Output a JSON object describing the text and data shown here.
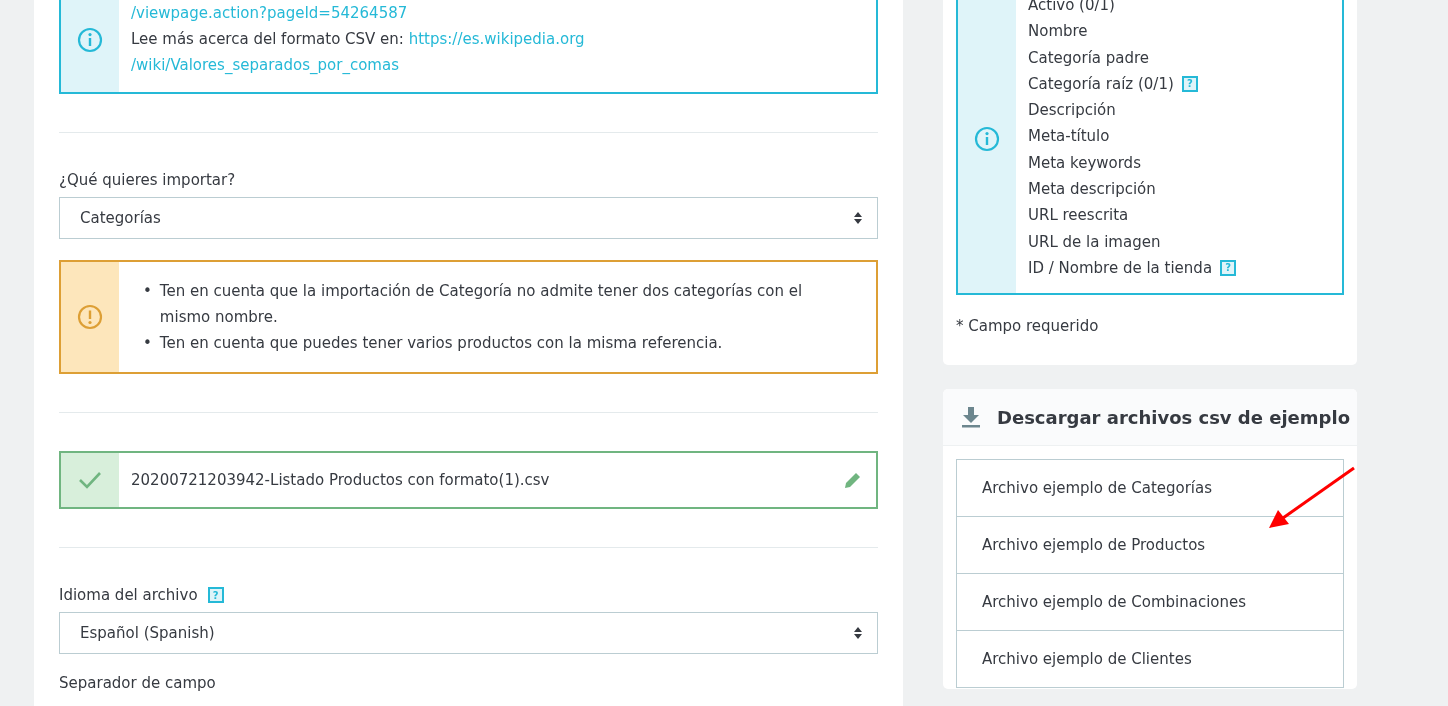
{
  "import_form": {
    "csv_info": {
      "lines": [
        {
          "link": "/viewpage.action?pageId=54264587"
        },
        {
          "text": "Lee más acerca del formato CSV en:",
          "link": "https://es.wikipedia.org"
        },
        {
          "link": "/wiki/Valores_separados_por_comas"
        }
      ]
    },
    "entity_select": {
      "label": "¿Qué quieres importar?",
      "value": "Categorías"
    },
    "warnings": [
      {
        "bullet": "•",
        "text": "Ten en cuenta que la importación de Categoría no admite tener dos categorías con el mismo nombre."
      },
      {
        "bullet": "•",
        "text": "Ten en cuenta que puedes tener varios productos con la misma referencia."
      }
    ],
    "uploaded_file": {
      "name": "20200721203942-Listado Productos con formato(1).csv"
    },
    "language_select": {
      "label": "Idioma del archivo",
      "help": "?",
      "value": "Español (Spanish)"
    },
    "next_label": "Separador de campo"
  },
  "fields_panel": {
    "fields": [
      {
        "label": "Activo (0/1)"
      },
      {
        "label": "Nombre"
      },
      {
        "label": "Categoría padre"
      },
      {
        "label": "Categoría raíz (0/1)",
        "help": "?"
      },
      {
        "label": "Descripción"
      },
      {
        "label": "Meta-título"
      },
      {
        "label": "Meta keywords"
      },
      {
        "label": "Meta descripción"
      },
      {
        "label": "URL reescrita"
      },
      {
        "label": "URL de la imagen"
      },
      {
        "label": "ID / Nombre de la tienda",
        "help": "?"
      }
    ],
    "required_note": "* Campo requerido"
  },
  "samples_panel": {
    "title": "Descargar archivos csv de ejemplo",
    "items": [
      "Archivo ejemplo de Categorías",
      "Archivo ejemplo de Productos",
      "Archivo ejemplo de Combinaciones",
      "Archivo ejemplo de Clientes"
    ]
  },
  "annotation": {
    "kind": "arrow"
  }
}
